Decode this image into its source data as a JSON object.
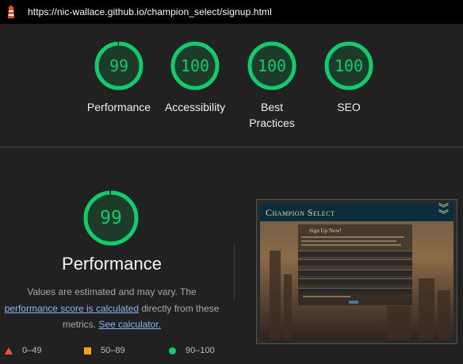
{
  "topbar": {
    "url": "https://nic-wallace.github.io/champion_select/signup.html",
    "icon": "lighthouse-icon"
  },
  "scores": [
    {
      "value": 99,
      "label": "Performance",
      "fraction": 0.99
    },
    {
      "value": 100,
      "label": "Accessibility",
      "fraction": 1.0
    },
    {
      "value": 100,
      "label": "Best Practices",
      "fraction": 1.0
    },
    {
      "value": 100,
      "label": "SEO",
      "fraction": 1.0
    }
  ],
  "performance": {
    "score": 99,
    "fraction": 0.99,
    "title": "Performance",
    "desc_start": "Values are estimated and may vary. The ",
    "link_score": "performance score is calculated",
    "desc_mid": " directly from these metrics. ",
    "link_calc": "See calculator."
  },
  "legend": {
    "fail": "0–49",
    "average": "50–89",
    "pass": "90–100"
  },
  "screenshot": {
    "title": "Champion Select",
    "heading": "Sign Up Now!"
  },
  "colors": {
    "pass": "#0cce6b",
    "average": "#ffa400",
    "fail": "#ff4e42",
    "link": "#8ab4f8"
  }
}
